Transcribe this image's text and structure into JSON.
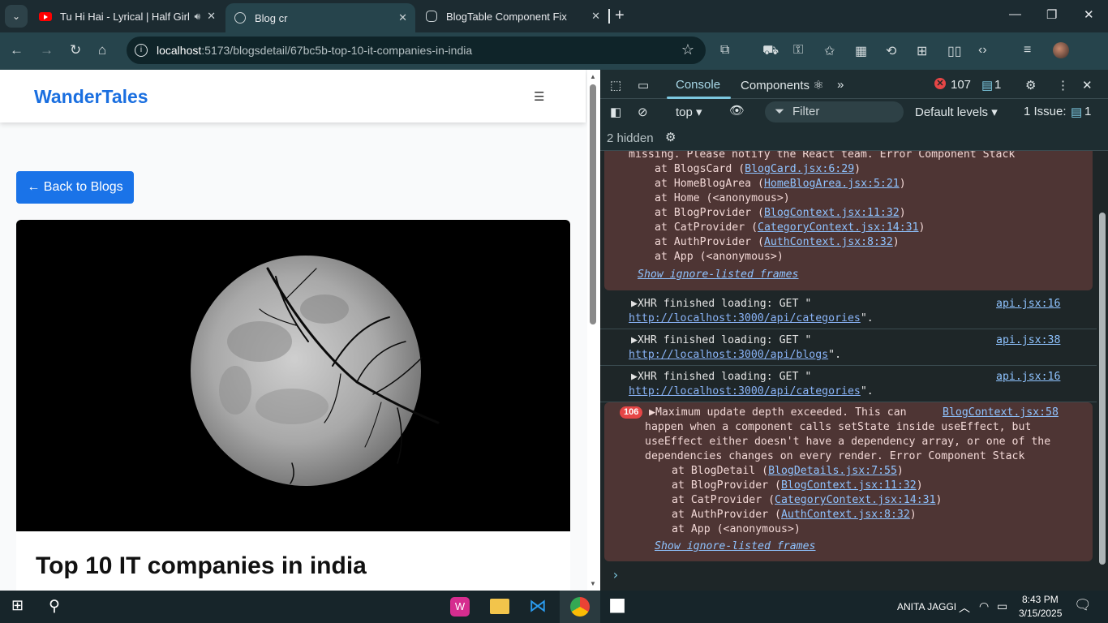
{
  "browser": {
    "tabs": [
      {
        "title": "Tu Hi Hai - Lyrical | Half Girl",
        "icon": "youtube-icon",
        "active": false
      },
      {
        "title": "Blog cr",
        "icon": "globe-icon",
        "active": true
      },
      {
        "title": "BlogTable Component Fix",
        "icon": "openai-icon",
        "active": false
      }
    ],
    "url_host": "localhost",
    "url_path": ":5173/blogsdetail/67bc5b-top-10-it-companies-in-india"
  },
  "page": {
    "brand": "WanderTales",
    "back_button": "← Back to Blogs",
    "post_title": "Top 10 IT companies in india"
  },
  "devtools": {
    "tabs": {
      "console": "Console",
      "components": "Components ⚛"
    },
    "error_count": "107",
    "message_count": "1",
    "context": "top",
    "filter_placeholder": "Filter",
    "levels": "Default levels",
    "issues_label": "1 Issue:",
    "issues_count": "1",
    "hidden": "2 hidden",
    "block1": {
      "line0": "missing. Please notify the React team. Error Component Stack",
      "stack": [
        {
          "pre": "at BlogsCard (",
          "link": "BlogCard.jsx:6:29",
          "post": ")"
        },
        {
          "pre": "at HomeBlogArea (",
          "link": "HomeBlogArea.jsx:5:21",
          "post": ")"
        },
        {
          "pre": "at Home (<anonymous>)",
          "link": "",
          "post": ""
        },
        {
          "pre": "at BlogProvider (",
          "link": "BlogContext.jsx:11:32",
          "post": ")"
        },
        {
          "pre": "at CatProvider (",
          "link": "CategoryContext.jsx:14:31",
          "post": ")"
        },
        {
          "pre": "at AuthProvider (",
          "link": "AuthContext.jsx:8:32",
          "post": ")"
        },
        {
          "pre": "at App (<anonymous>)",
          "link": "",
          "post": ""
        }
      ],
      "show_ignored": "Show ignore-listed frames"
    },
    "xhr": [
      {
        "text": "▶XHR finished loading: GET \"",
        "url": "http://localhost:3000/api/categories",
        "end": "\".",
        "source": "api.jsx:16"
      },
      {
        "text": "▶XHR finished loading: GET \"",
        "url": "http://localhost:3000/api/blogs",
        "end": "\".",
        "source": "api.jsx:38"
      },
      {
        "text": "▶XHR finished loading: GET \"",
        "url": "http://localhost:3000/api/categories",
        "end": "\".",
        "source": "api.jsx:16"
      }
    ],
    "block2": {
      "badge": "106",
      "source": "BlogContext.jsx:58",
      "lines": [
        "▶Maximum update depth exceeded. This can",
        "happen when a component calls setState inside useEffect, but",
        "useEffect either doesn't have a dependency array, or one of the",
        "dependencies changes on every render. Error Component Stack"
      ],
      "stack": [
        {
          "pre": "at BlogDetail (",
          "link": "BlogDetails.jsx:7:55",
          "post": ")"
        },
        {
          "pre": "at BlogProvider (",
          "link": "BlogContext.jsx:11:32",
          "post": ")"
        },
        {
          "pre": "at CatProvider (",
          "link": "CategoryContext.jsx:14:31",
          "post": ")"
        },
        {
          "pre": "at AuthProvider (",
          "link": "AuthContext.jsx:8:32",
          "post": ")"
        },
        {
          "pre": "at App (<anonymous>)",
          "link": "",
          "post": ""
        }
      ],
      "show_ignored": "Show ignore-listed frames"
    }
  },
  "taskbar": {
    "user": "ANITA JAGGI",
    "time": "8:43 PM",
    "date": "3/15/2025"
  }
}
